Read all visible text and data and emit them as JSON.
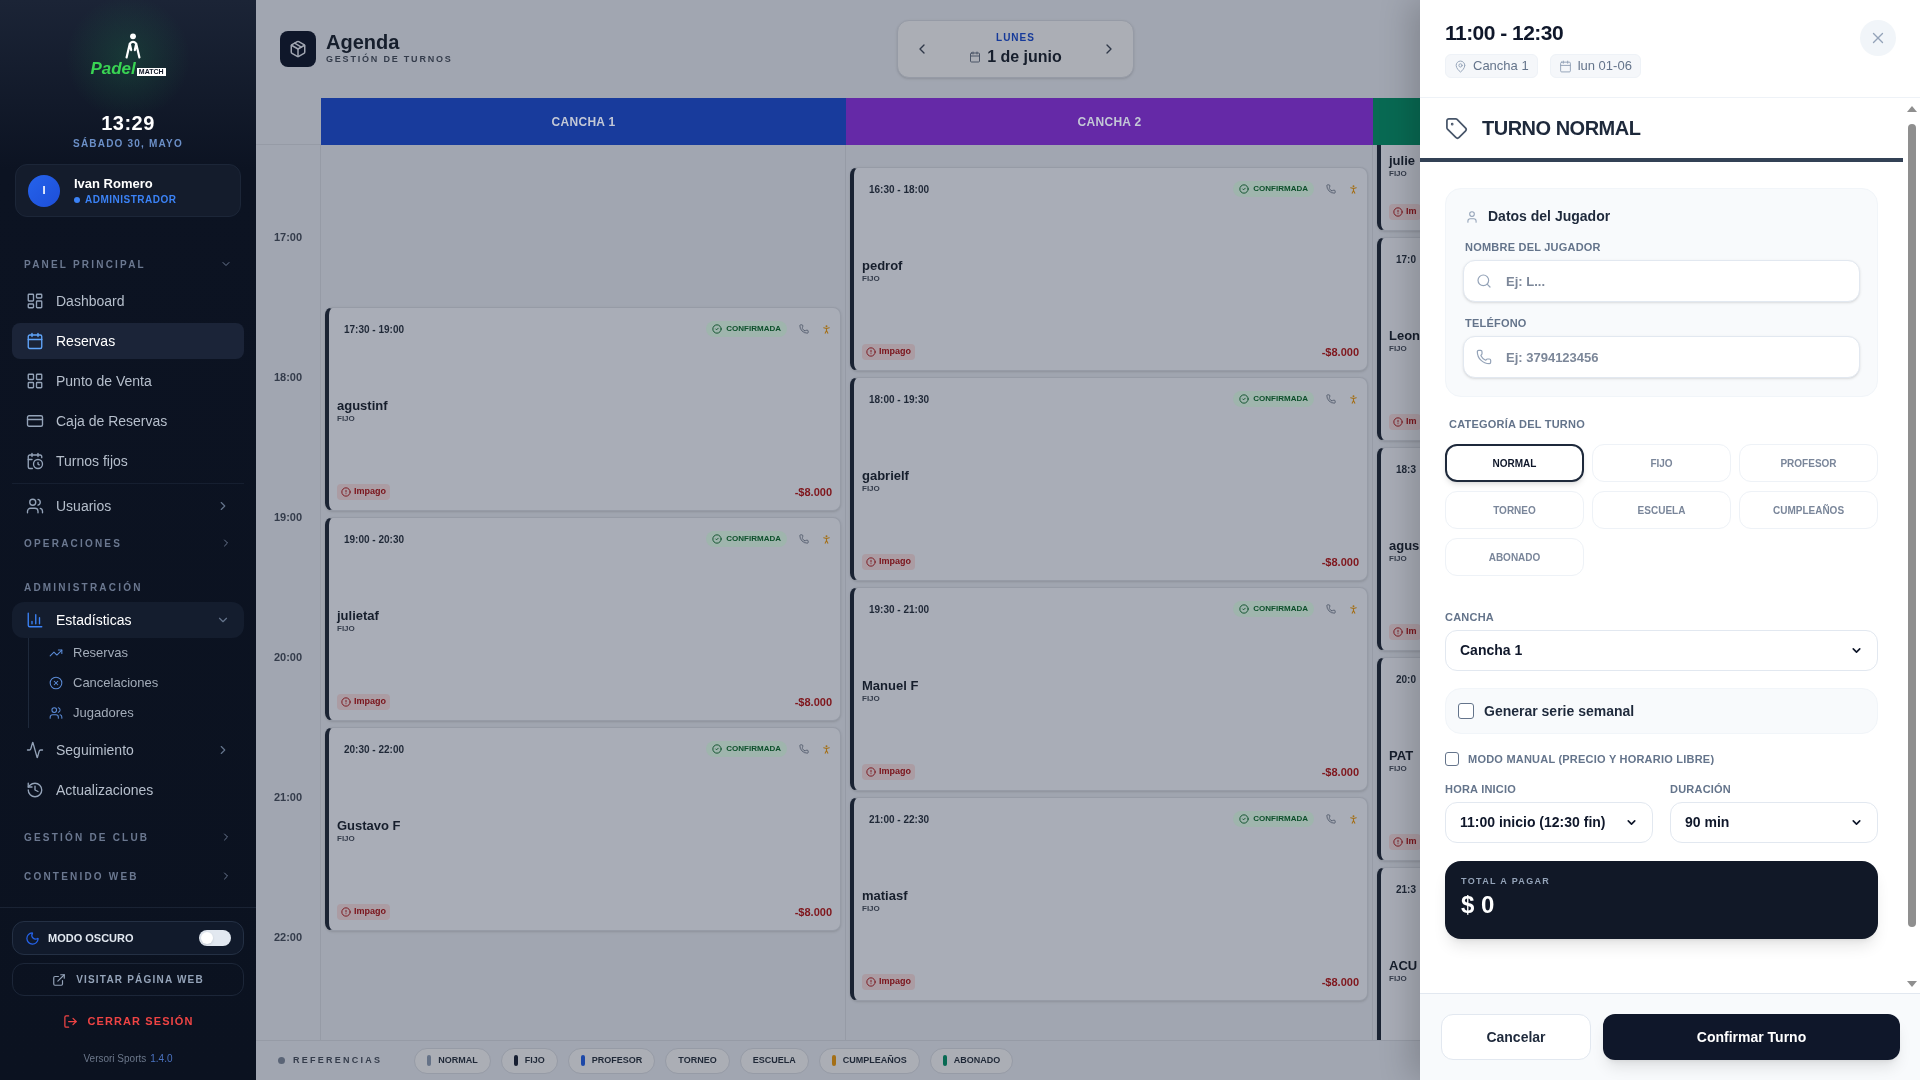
{
  "sidebar": {
    "logo": {
      "word": "Padel",
      "badge": "MATCH"
    },
    "clock": {
      "time": "13:29",
      "date": "SÁBADO 30, MAYO"
    },
    "user": {
      "initial": "I",
      "name": "Ivan Romero",
      "role": "ADMINISTRADOR"
    },
    "sections": [
      {
        "title": "PANEL PRINCIPAL",
        "collapsible": true,
        "expanded": true,
        "items": [
          {
            "kind": "link",
            "label": "Dashboard",
            "selected": false
          },
          {
            "kind": "link",
            "label": "Reservas",
            "selected": true
          },
          {
            "kind": "link",
            "label": "Punto de Venta",
            "selected": false
          },
          {
            "kind": "link",
            "label": "Caja de Reservas",
            "selected": false
          },
          {
            "kind": "link",
            "label": "Turnos fijos",
            "selected": false
          },
          {
            "kind": "group",
            "label": "Usuarios",
            "expanded": false
          }
        ]
      },
      {
        "title": "OPERACIONES",
        "collapsible": true,
        "expanded": false
      },
      {
        "title": "ADMINISTRACIÓN",
        "collapsible": false,
        "expanded": true,
        "items": [
          {
            "kind": "group",
            "label": "Estadísticas",
            "expanded": true,
            "children": [
              {
                "label": "Reservas",
                "selected": false
              },
              {
                "label": "Cancelaciones",
                "selected": false
              },
              {
                "label": "Jugadores",
                "selected": false
              }
            ]
          },
          {
            "kind": "group",
            "label": "Seguimiento",
            "expanded": false
          },
          {
            "kind": "link",
            "label": "Actualizaciones",
            "selected": false
          }
        ]
      },
      {
        "title": "GESTIÓN DE CLUB",
        "collapsible": true,
        "expanded": false
      },
      {
        "title": "CONTENIDO WEB",
        "collapsible": true,
        "expanded": false
      }
    ],
    "dark_mode": {
      "label": "MODO OSCURO",
      "on": false
    },
    "visit_link": "VISITAR PÁGINA WEB",
    "logout": "CERRAR SESIÓN",
    "footer": {
      "brand": "Versori Sports",
      "version": "1.4.0"
    }
  },
  "agenda": {
    "title": "Agenda",
    "subtitle": "GESTIÓN DE TURNOS",
    "date_nav": {
      "weekday": "LUNES",
      "date": "1 de junio"
    },
    "hours": [
      "17:00",
      "18:00",
      "19:00",
      "20:00",
      "21:00",
      "22:00"
    ],
    "courts": [
      {
        "name": "CANCHA 1",
        "color": "#183b9c",
        "bookings": [
          {
            "time": "17:30 - 19:00",
            "status": "CONFIRMADA",
            "player": "agustinf",
            "type": "FIJO",
            "payment": "Impago",
            "amount": "-$8.000"
          },
          {
            "time": "19:00 - 20:30",
            "status": "CONFIRMADA",
            "player": "julietaf",
            "type": "FIJO",
            "payment": "Impago",
            "amount": "-$8.000"
          },
          {
            "time": "20:30 - 22:00",
            "status": "CONFIRMADA",
            "player": "Gustavo F",
            "type": "FIJO",
            "payment": "Impago",
            "amount": "-$8.000"
          }
        ]
      },
      {
        "name": "CANCHA 2",
        "color": "#6529a7",
        "bookings": [
          {
            "time": "16:30 - 18:00",
            "status": "CONFIRMADA",
            "player": "pedrof",
            "type": "FIJO",
            "payment": "Impago",
            "amount": "-$8.000"
          },
          {
            "time": "18:00 - 19:30",
            "status": "CONFIRMADA",
            "player": "gabrielf",
            "type": "FIJO",
            "payment": "Impago",
            "amount": "-$8.000"
          },
          {
            "time": "19:30 - 21:00",
            "status": "CONFIRMADA",
            "player": "Manuel F",
            "type": "FIJO",
            "payment": "Impago",
            "amount": "-$8.000"
          },
          {
            "time": "21:00 - 22:30",
            "status": "CONFIRMADA",
            "player": "matiasf",
            "type": "FIJO",
            "payment": "Impago",
            "amount": "-$8.000"
          }
        ]
      },
      {
        "color": "#086a53",
        "bookings": [
          {
            "player": "julie",
            "type": "FIJO",
            "payment": "Im"
          },
          {
            "time": "17:0",
            "player": "Leon",
            "type": "FIJO",
            "payment": "Im"
          },
          {
            "time": "18:3",
            "player": "agus",
            "type": "FIJO",
            "payment": "Im"
          },
          {
            "time": "20:0",
            "player": "PAT",
            "type": "FIJO",
            "payment": "Im"
          },
          {
            "time": "21:3",
            "player": "ACU",
            "type": "FIJO"
          }
        ]
      }
    ],
    "legend": {
      "title": "REFERENCIAS",
      "items": [
        {
          "label": "NORMAL",
          "color": "#657287"
        },
        {
          "label": "FIJO",
          "color": "#171f32"
        },
        {
          "label": "PROFESOR",
          "color": "#1d48a8"
        },
        {
          "label": "TORNEO"
        },
        {
          "label": "ESCUELA"
        },
        {
          "label": "CUMPLEAÑOS",
          "color": "#a46f16"
        },
        {
          "label": "ABONADO",
          "color": "#086a53"
        }
      ]
    }
  },
  "booking_panel": {
    "title": "11:00 - 12:30",
    "court": "Cancha 1",
    "date": "lun 01-06",
    "category_heading": "TURNO NORMAL",
    "player_card": {
      "title": "Datos del Jugador",
      "fields": [
        {
          "label": "NOMBRE DEL JUGADOR",
          "placeholder": "Ej: L..."
        },
        {
          "label": "TELÉFONO",
          "placeholder": "Ej: 3794123456"
        }
      ]
    },
    "category": {
      "label": "CATEGORÍA DEL TURNO",
      "options": [
        {
          "label": "NORMAL",
          "selected": true
        },
        {
          "label": "FIJO",
          "selected": false
        },
        {
          "label": "PROFESOR",
          "selected": false
        },
        {
          "label": "TORNEO",
          "selected": false
        },
        {
          "label": "ESCUELA",
          "selected": false
        },
        {
          "label": "CUMPLEAÑOS",
          "selected": false
        },
        {
          "label": "ABONADO",
          "selected": false
        }
      ]
    },
    "court_select": {
      "label": "CANCHA",
      "value": "Cancha 1"
    },
    "weekly_series": {
      "label": "Generar serie semanal",
      "checked": false
    },
    "manual_mode": {
      "label": "MODO MANUAL (PRECIO Y HORARIO LIBRE)",
      "checked": false
    },
    "start_time": {
      "label": "HORA INICIO",
      "value": "11:00 inicio (12:30 fin)"
    },
    "duration": {
      "label": "DURACIÓN",
      "value": "90 min"
    },
    "total": {
      "label": "TOTAL A PAGAR",
      "value": "$ 0"
    },
    "buttons": [
      {
        "kind": "secondary",
        "label": "Cancelar"
      },
      {
        "kind": "primary",
        "label": "Confirmar Turno"
      }
    ]
  }
}
